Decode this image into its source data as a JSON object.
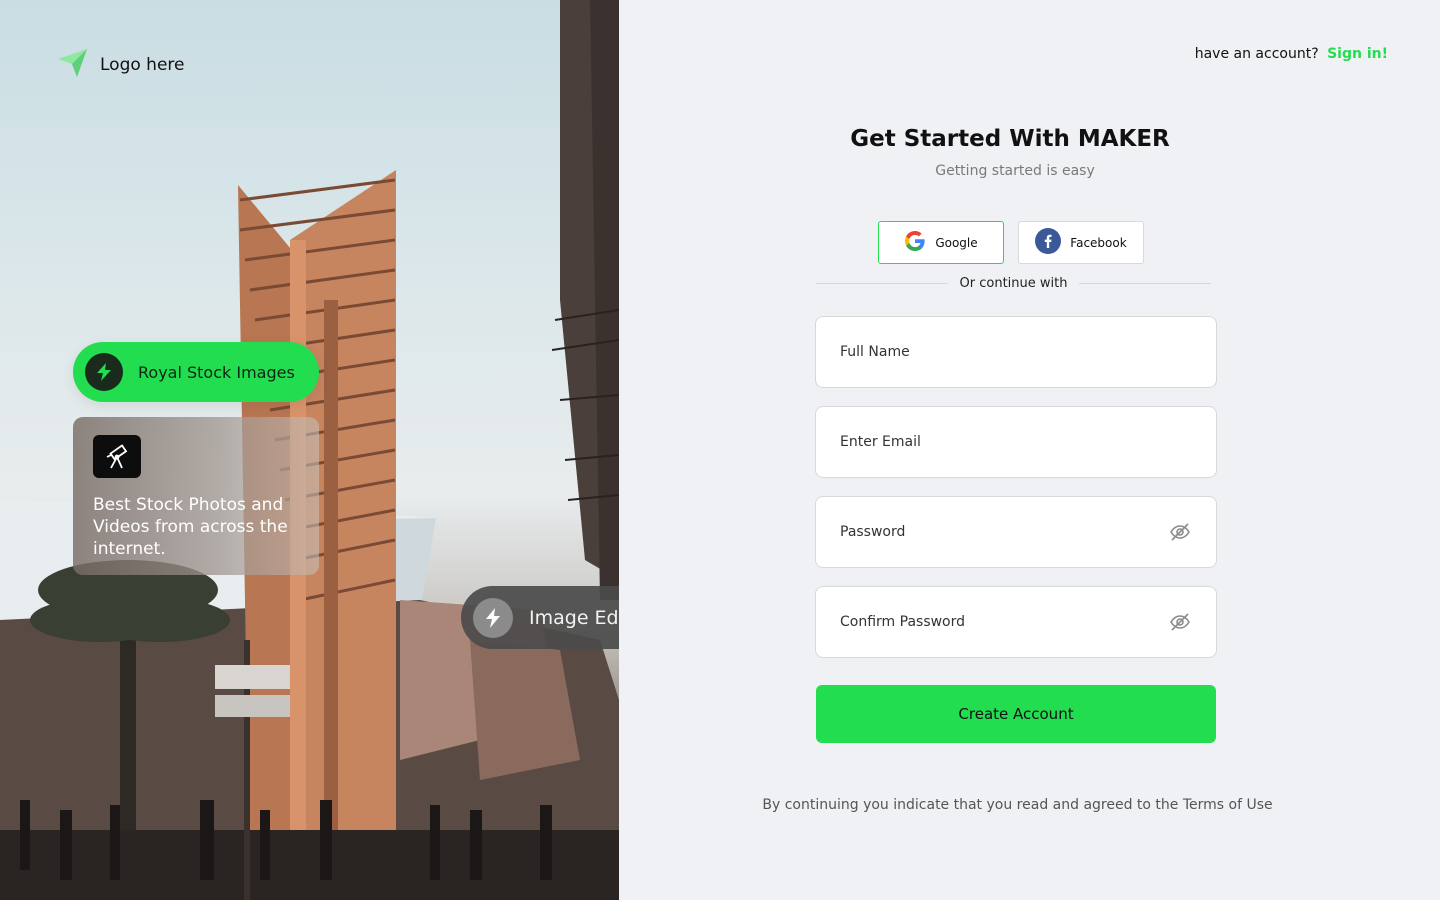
{
  "brand": {
    "logo_text": "Logo here",
    "accent": "#22dd4f",
    "logo_icon": "paper-plane-icon"
  },
  "left_panel": {
    "pill_top": {
      "label": "Royal Stock Images",
      "icon": "lightning-icon"
    },
    "card": {
      "text": "Best Stock Photos and Videos from across the internet.",
      "icon": "telescope-icon"
    },
    "pill_bottom": {
      "label": "Image Editor",
      "icon": "lightning-icon"
    }
  },
  "header": {
    "prompt": "have an account?",
    "signin_label": "Sign in!"
  },
  "form": {
    "title": "Get Started With MAKER",
    "subtitle": "Getting started is easy",
    "social": {
      "google_label": "Google",
      "facebook_label": "Facebook"
    },
    "divider_text": "Or continue with",
    "fields": {
      "full_name_placeholder": "Full Name",
      "email_placeholder": "Enter Email",
      "password_placeholder": "Password",
      "confirm_password_placeholder": "Confirm Password"
    },
    "submit_label": "Create Account",
    "terms_text": "By continuing you indicate that you read and agreed to the Terms of Use"
  }
}
